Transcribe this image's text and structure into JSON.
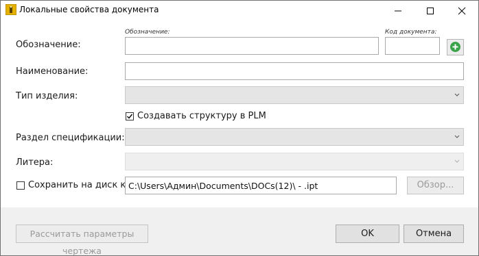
{
  "window": {
    "title": "Локальные свойства документа"
  },
  "form": {
    "designation_label": "Обозначение:",
    "designation_hint": "Обозначение:",
    "designation_value": "",
    "doc_code_hint": "Код документа:",
    "doc_code_value": "",
    "add_icon": "plus-circle-icon",
    "name_label": "Наименование:",
    "name_value": "",
    "product_type_label": "Тип изделия:",
    "product_type_value": "",
    "create_plm_label": "Создавать структуру в PLM",
    "create_plm_checked": true,
    "spec_section_label": "Раздел спецификации:",
    "spec_section_value": "",
    "letter_label": "Литера:",
    "letter_value": "",
    "save_to_disk_label": "Сохранить на диск как:",
    "save_to_disk_checked": false,
    "save_path": "C:\\Users\\Админ\\Documents\\DOCs(12)\\ - .ipt",
    "browse_label": "Обзор..."
  },
  "footer": {
    "calc_label": "Рассчитать параметры чертежа",
    "ok_label": "OK",
    "cancel_label": "Отмена"
  },
  "colors": {
    "add_button": "#3aa34a",
    "app_icon": "#e4b100"
  }
}
